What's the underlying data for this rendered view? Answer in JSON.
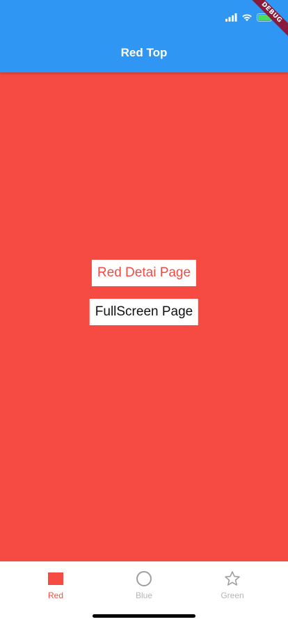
{
  "app_bar": {
    "title": "Red Top",
    "color": "#2f96f3"
  },
  "debug_banner": {
    "label": "DEBUG"
  },
  "content": {
    "background": "#f64b43",
    "buttons": {
      "red_detail": "Red Detai Page",
      "fullscreen": "FullScreen Page"
    }
  },
  "bottom_nav": {
    "items": [
      {
        "label": "Red",
        "icon": "square-icon",
        "color": "#f64b43",
        "active": true
      },
      {
        "label": "Blue",
        "icon": "circle-icon",
        "color": "#b4b4b4",
        "active": false
      },
      {
        "label": "Green",
        "icon": "star-icon",
        "color": "#b4b4b4",
        "active": false
      }
    ]
  }
}
